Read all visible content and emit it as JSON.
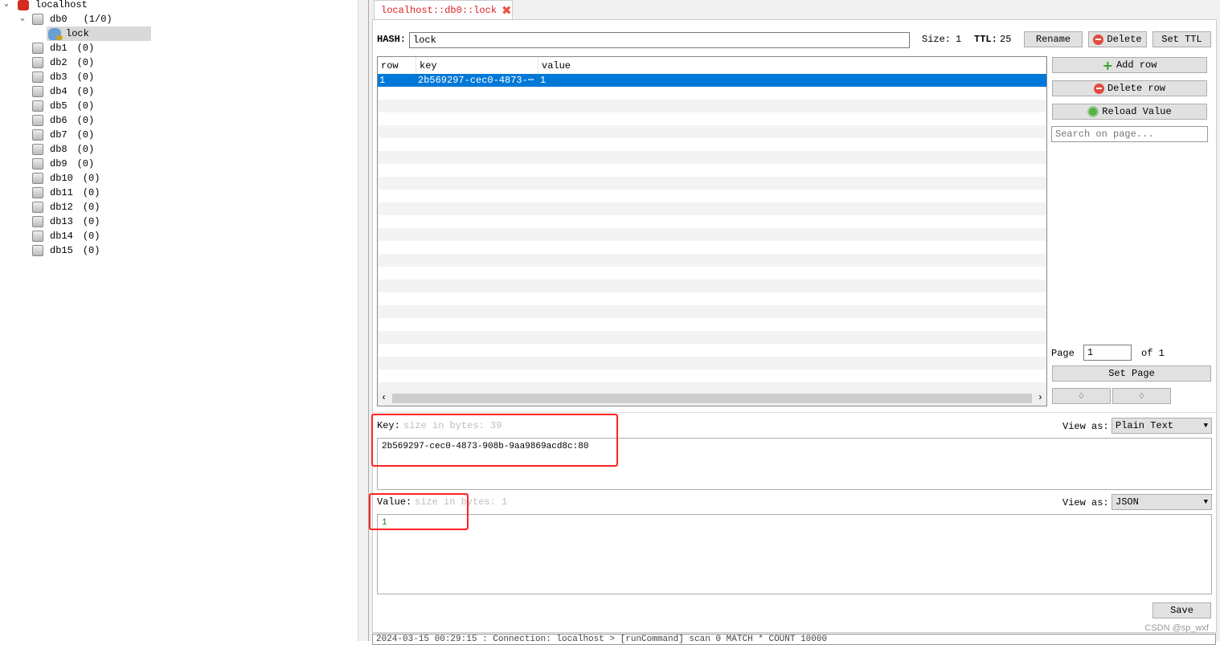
{
  "tree": {
    "server": "localhost",
    "databases": [
      {
        "name": "db0",
        "count": "(1/0)",
        "expanded": true,
        "keys": [
          "lock"
        ]
      },
      {
        "name": "db1",
        "count": "(0)"
      },
      {
        "name": "db2",
        "count": "(0)"
      },
      {
        "name": "db3",
        "count": "(0)"
      },
      {
        "name": "db4",
        "count": "(0)"
      },
      {
        "name": "db5",
        "count": "(0)"
      },
      {
        "name": "db6",
        "count": "(0)"
      },
      {
        "name": "db7",
        "count": "(0)"
      },
      {
        "name": "db8",
        "count": "(0)"
      },
      {
        "name": "db9",
        "count": "(0)"
      },
      {
        "name": "db10",
        "count": "(0)"
      },
      {
        "name": "db11",
        "count": "(0)"
      },
      {
        "name": "db12",
        "count": "(0)"
      },
      {
        "name": "db13",
        "count": "(0)"
      },
      {
        "name": "db14",
        "count": "(0)"
      },
      {
        "name": "db15",
        "count": "(0)"
      }
    ]
  },
  "tab": {
    "label": "localhost::db0::lock"
  },
  "header": {
    "type_label": "HASH:",
    "key_name": "lock",
    "size_label": "Size:",
    "size": "1",
    "ttl_label": "TTL:",
    "ttl": "25",
    "rename": "Rename",
    "delete": "Delete",
    "set_ttl": "Set TTL"
  },
  "table": {
    "columns": [
      "row",
      "key",
      "value"
    ],
    "rows": [
      [
        "1",
        "2b569297-cec0-4873-⋯",
        "1"
      ]
    ]
  },
  "side": {
    "add_row": "Add row",
    "delete_row": "Delete row",
    "reload": "Reload Value",
    "search_placeholder": "Search on page...",
    "page_label": "Page",
    "page": "1",
    "of_label": "of 1",
    "set_page": "Set Page",
    "prev": "♢",
    "next": "♢"
  },
  "key_editor": {
    "label": "Key:",
    "size_hint": "size in bytes: 39",
    "view_as": "View as:",
    "format": "Plain Text",
    "value": "2b569297-cec0-4873-908b-9aa9869acd8c:80"
  },
  "value_editor": {
    "label": "Value:",
    "size_hint": "size in bytes: 1",
    "view_as": "View as:",
    "format": "JSON",
    "value": "1"
  },
  "save": "Save",
  "status": "2024-03-15 00:29:15 : Connection: localhost > [runCommand] scan 0 MATCH * COUNT 10000",
  "watermark": "CSDN @sp_wxf",
  "colors": {
    "accent": "#0078d7",
    "tab_text": "#d9201e",
    "highlight_box": "#ff2222"
  }
}
